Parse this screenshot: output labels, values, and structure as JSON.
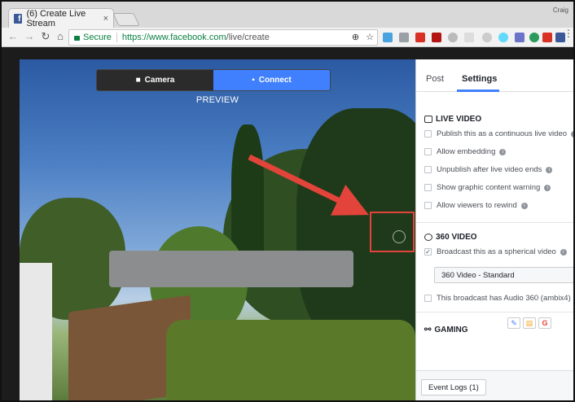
{
  "browser": {
    "tab_title": "(6) Create Live Stream",
    "tab_close": "×",
    "user": "Craig",
    "secure_label": "Secure",
    "url_host": "https://www.facebook.com",
    "url_path": "/live/create"
  },
  "video": {
    "camera_label": "Camera",
    "connect_label": "Connect",
    "preview_label": "PREVIEW",
    "annotation_color": "#e2443b"
  },
  "panel": {
    "tabs": [
      "Post",
      "Settings"
    ],
    "active_tab": "Settings",
    "live_video": {
      "title": "LIVE VIDEO",
      "options": [
        "Publish this as a continuous live video",
        "Allow embedding",
        "Unpublish after live video ends",
        "Show graphic content warning",
        "Allow viewers to rewind"
      ]
    },
    "video360": {
      "title": "360 VIDEO",
      "spherical_label": "Broadcast this as a spherical video",
      "spherical_checked": true,
      "select_value": "360 Video - Standard",
      "audio_label": "This broadcast has Audio 360 (ambix4)"
    },
    "gaming": {
      "title": "GAMING"
    },
    "event_logs_label": "Event Logs (1)"
  },
  "colors": {
    "accent": "#4080ff",
    "facebook": "#3b5998"
  }
}
